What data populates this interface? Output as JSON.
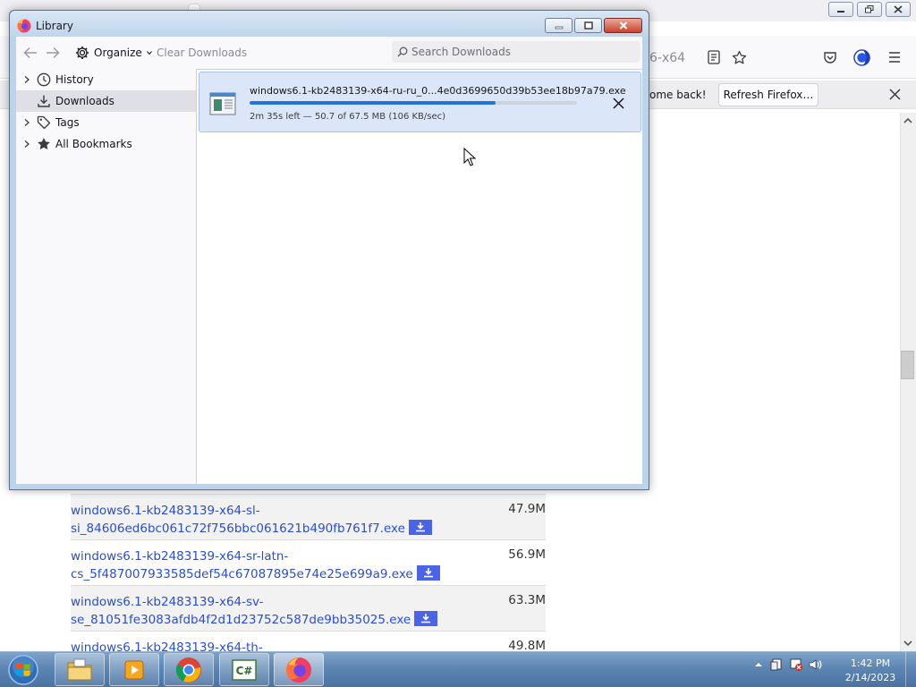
{
  "library": {
    "window_title": "Library",
    "toolbar": {
      "organize_label": "Organize",
      "clear_downloads_label": "Clear Downloads",
      "search_placeholder": "Search Downloads"
    },
    "tree": [
      {
        "label": "History",
        "icon": "clock-icon",
        "expandable": true,
        "selected": false
      },
      {
        "label": "Downloads",
        "icon": "download-icon",
        "expandable": false,
        "selected": true
      },
      {
        "label": "Tags",
        "icon": "tag-icon",
        "expandable": true,
        "selected": false
      },
      {
        "label": "All Bookmarks",
        "icon": "star-icon",
        "expandable": true,
        "selected": false
      }
    ],
    "download": {
      "filename": "windows6.1-kb2483139-x64-ru-ru_0...4e0d3699650d39b53ee18b97a79.exe",
      "status": "2m 35s left — 50.7 of 67.5 MB (106 KB/sec)",
      "progress_fraction": 0.751
    }
  },
  "browser": {
    "url_fragment": "6-x64",
    "notification_text": "ome back!",
    "refresh_button_label": "Refresh Firefox…"
  },
  "files": [
    {
      "line1": "windows6.1-kb2483139-x64-sl-",
      "line2": "si_84606ed6bc061c72f756bbc061621b490fb761f7.exe",
      "size": "47.9M"
    },
    {
      "line1": "windows6.1-kb2483139-x64-sr-latn-",
      "line2": "cs_5f487007933585def54c67087895e74e25e699a9.exe",
      "size": "56.9M"
    },
    {
      "line1": "windows6.1-kb2483139-x64-sv-",
      "line2": "se_81051fe3083afdb4f2d1d23752c587de9bb35025.exe",
      "size": "63.3M"
    },
    {
      "line1": "windows6.1-kb2483139-x64-th-",
      "line2": "",
      "size": "49.8M"
    }
  ],
  "taskbar": {
    "apps": [
      "explorer",
      "media-player",
      "chrome",
      "csharp-ide",
      "firefox"
    ],
    "time": "1:42 PM",
    "date": "2/14/2023"
  },
  "colors": {
    "accent_progress": "#2473d6",
    "download_button": "#4b63e6",
    "link": "#2a4ed0"
  }
}
